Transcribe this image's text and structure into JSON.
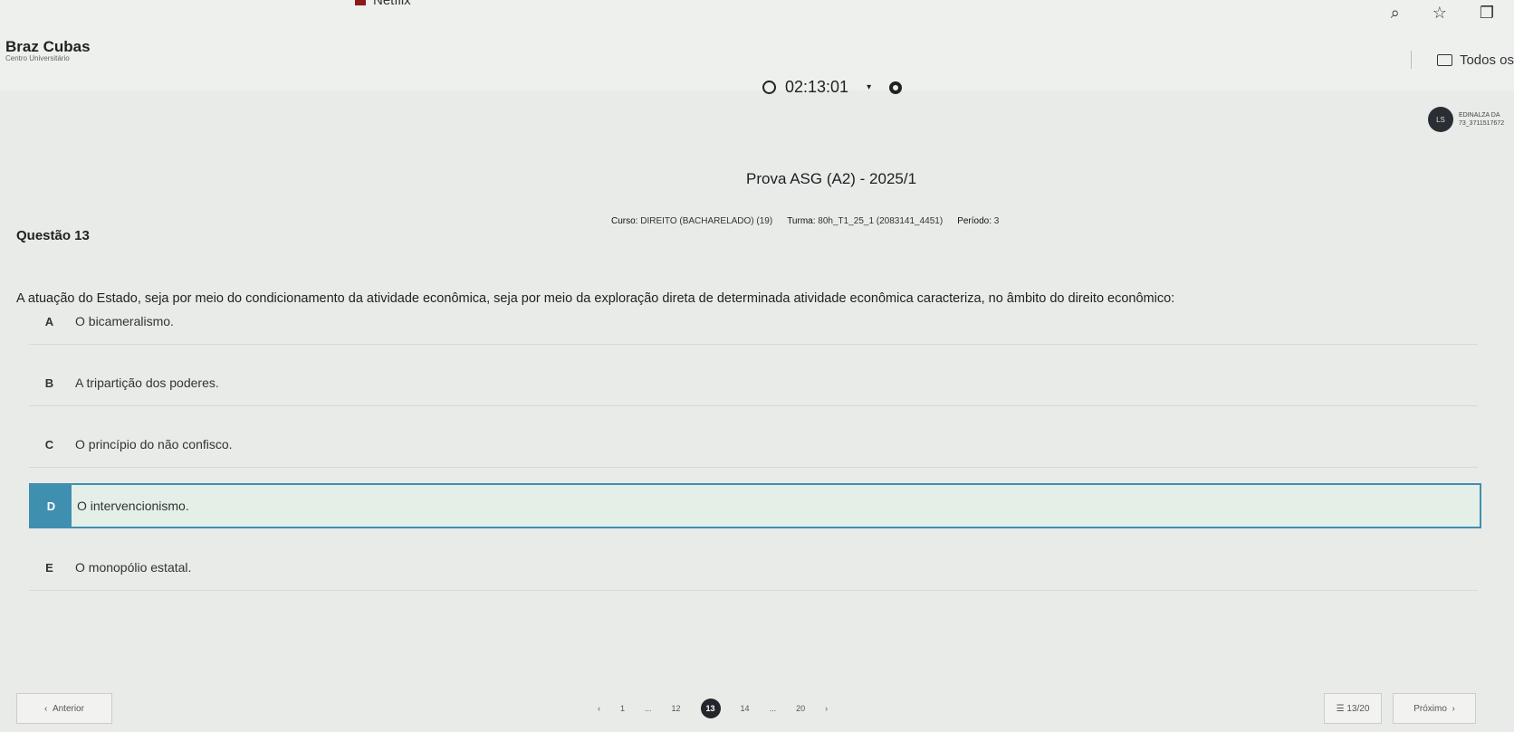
{
  "browser": {
    "tab_title": "Netflix",
    "bookmarks_label": "Todos os"
  },
  "brand": {
    "name": "Braz Cubas",
    "subtitle": "Centro Universitário"
  },
  "timer": {
    "value": "02:13:01"
  },
  "user": {
    "avatar_text": "LS",
    "name_line1": "EDINALZA DA",
    "name_line2": "73_3711517672"
  },
  "exam": {
    "title": "Prova ASG (A2) - 2025/1",
    "curso_label": "Curso:",
    "curso_value": "DIREITO (BACHARELADO) (19)",
    "turma_label": "Turma:",
    "turma_value": "80h_T1_25_1 (2083141_4451)",
    "periodo_label": "Período:",
    "periodo_value": "3"
  },
  "question": {
    "label": "Questão 13",
    "text": "A atuação do Estado, seja por meio do condicionamento da atividade econômica, seja por meio da exploração direta de determinada atividade econômica caracteriza, no âmbito do direito econômico:",
    "options": [
      {
        "letter": "A",
        "text": "O bicameralismo."
      },
      {
        "letter": "B",
        "text": "A tripartição dos poderes."
      },
      {
        "letter": "C",
        "text": "O princípio do não confisco."
      },
      {
        "letter": "D",
        "text": "O intervencionismo."
      },
      {
        "letter": "E",
        "text": "O monopólio estatal."
      }
    ],
    "selected": "D"
  },
  "footer": {
    "prev_label": "Anterior",
    "pages": [
      "1",
      "...",
      "12",
      "13",
      "14",
      "...",
      "20"
    ],
    "current_page": "13",
    "progress": "13/20",
    "next_label": "Próximo"
  }
}
